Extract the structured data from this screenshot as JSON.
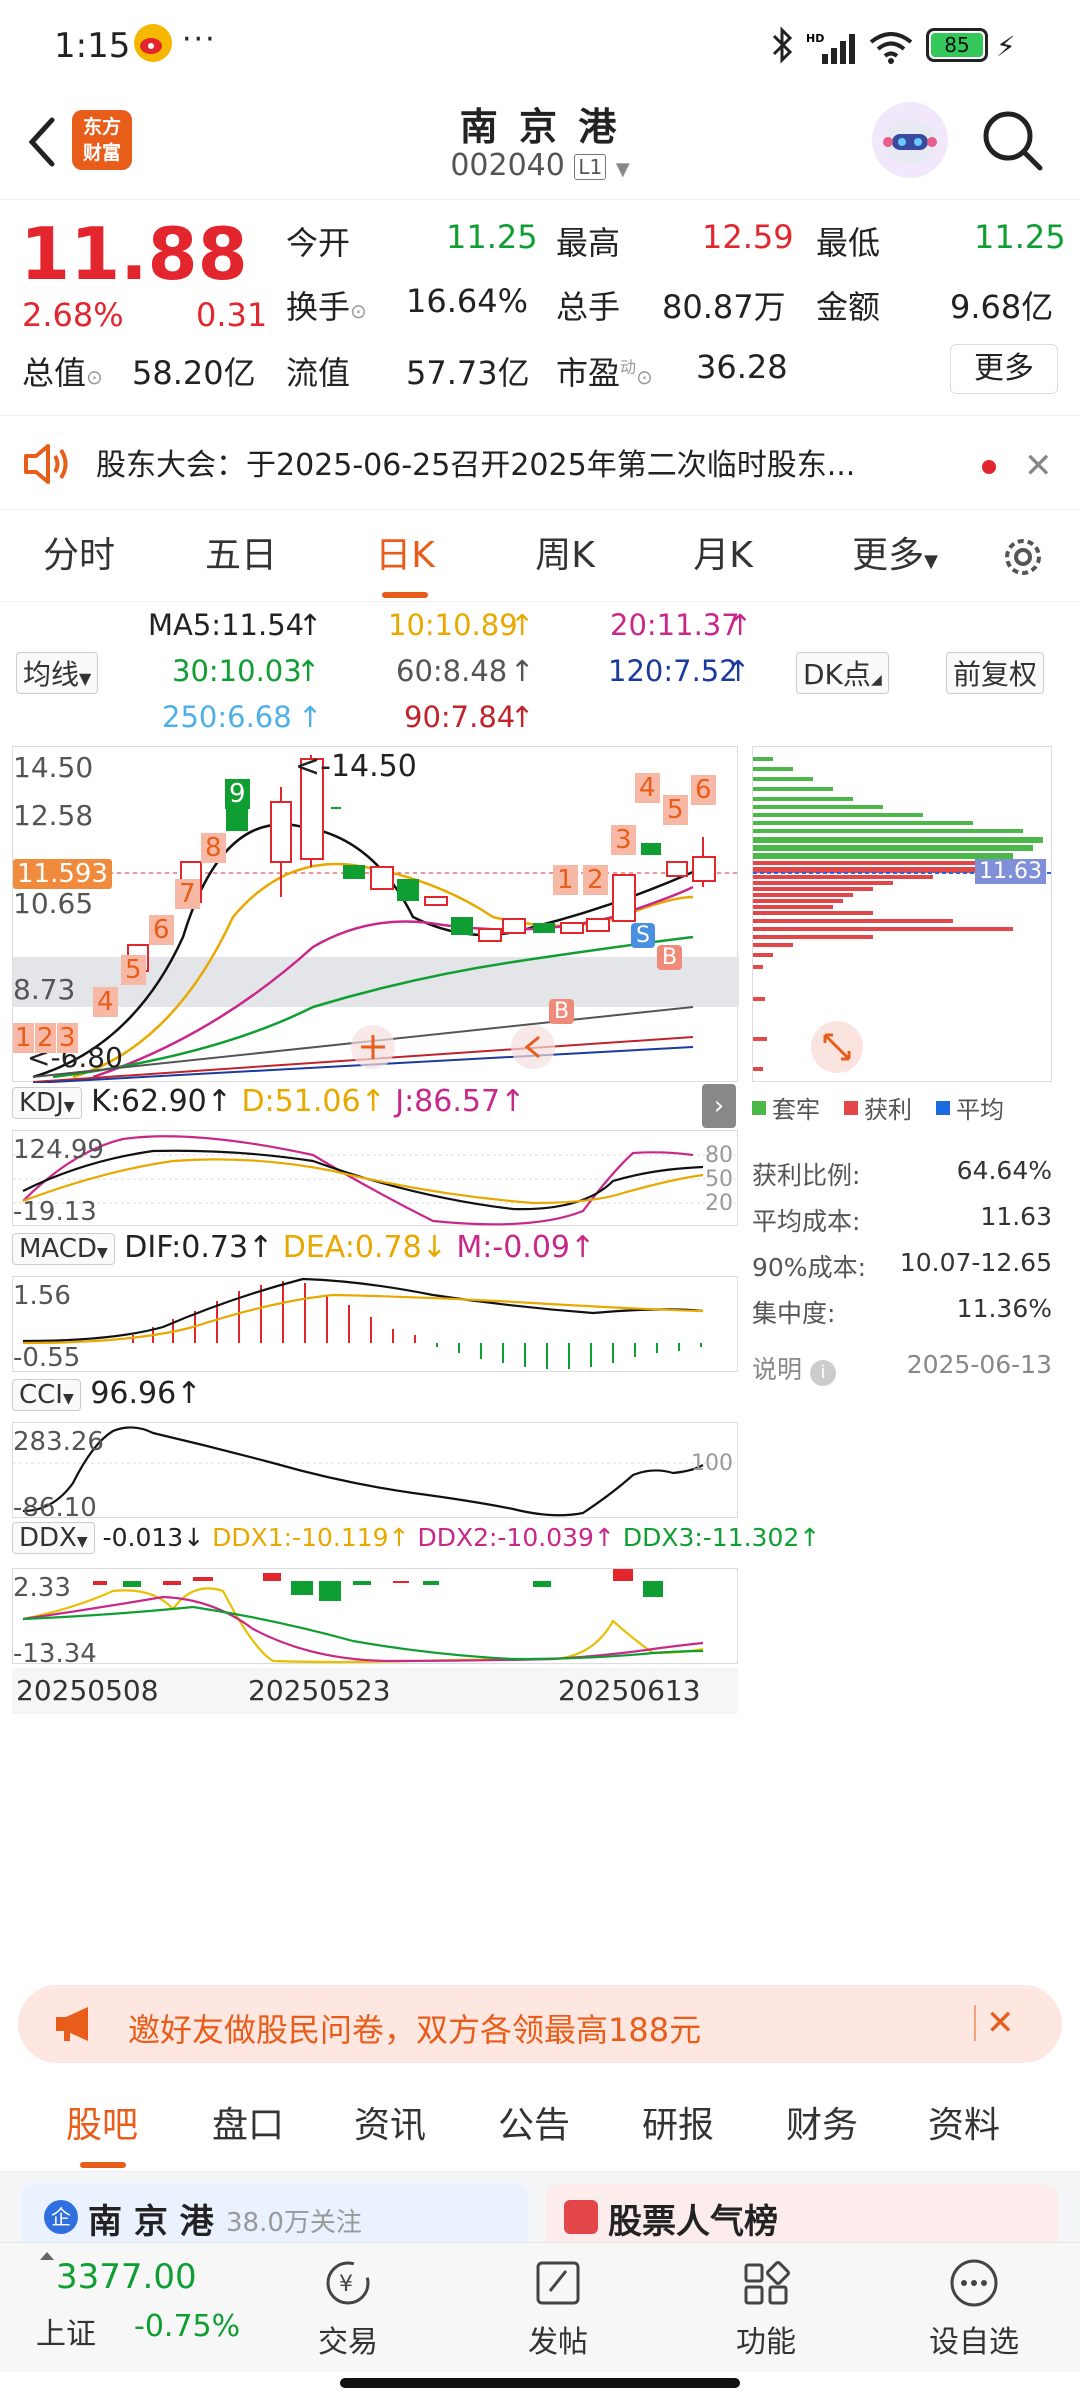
{
  "status_bar": {
    "time": "1:15",
    "dots": "···",
    "battery": "85"
  },
  "header": {
    "logo_line1": "东方",
    "logo_line2": "财富",
    "title": "南 京 港",
    "code": "002040",
    "level": "L1"
  },
  "quote": {
    "price": "11.88",
    "change_pct": "2.68%",
    "change": "0.31",
    "open_label": "今开",
    "open": "11.25",
    "high_label": "最高",
    "high": "12.59",
    "low_label": "最低",
    "low": "11.25",
    "turnover_label": "换手",
    "turnover": "16.64%",
    "vol_label": "总手",
    "vol": "80.87万",
    "amount_label": "金额",
    "amount": "9.68亿",
    "mcap_label": "总值",
    "mcap": "58.20亿",
    "float_label": "流值",
    "float": "57.73亿",
    "pe_label": "市盈",
    "pe_sup": "动",
    "pe": "36.28",
    "more": "更多"
  },
  "notice": {
    "text": "股东大会：于2025-06-25召开2025年第二次临时股东..."
  },
  "chart_tabs": [
    "分时",
    "五日",
    "日K",
    "周K",
    "月K",
    "更多"
  ],
  "ma": {
    "ma5": "MA5:11.54",
    "ma10": "10:10.89",
    "ma20": "20:11.37",
    "ma30": "30:10.03",
    "ma60": "60:8.48",
    "ma120": "120:7.52",
    "ma250": "250:6.68",
    "ma90": "90:7.84",
    "mode": "均线",
    "dk": "DK点",
    "adj": "前复权"
  },
  "kline": {
    "ticks": [
      "14.50",
      "12.58",
      "10.65",
      "8.73"
    ],
    "cur": "11.593",
    "hi_mark": "14.50",
    "lo_mark": "6.80",
    "seq": [
      "1",
      "2",
      "3",
      "4",
      "5",
      "6",
      "7",
      "8",
      "9",
      "1",
      "2",
      "3",
      "4",
      "5",
      "6"
    ],
    "signals": [
      "S",
      "B",
      "B"
    ]
  },
  "kdj": {
    "name": "KDJ",
    "k": "K:62.90",
    "d": "D:51.06",
    "j": "J:86.57",
    "top": "124.99",
    "bottom": "-19.13",
    "r80": "80",
    "r50": "50",
    "r20": "20"
  },
  "macd": {
    "name": "MACD",
    "dif": "DIF:0.73",
    "dea": "DEA:0.78",
    "m": "M:-0.09",
    "top": "1.56",
    "bottom": "-0.55"
  },
  "cci": {
    "name": "CCI",
    "v": "96.96",
    "top": "283.26",
    "bottom": "-86.10",
    "r100": "100"
  },
  "ddx": {
    "name": "DDX",
    "v": "-0.013",
    "d1": "DDX1:-10.119",
    "d2": "DDX2:-10.039",
    "d3": "DDX3:-11.302",
    "top": "2.33",
    "bottom": "-13.34"
  },
  "dates": [
    "20250508",
    "20250523",
    "20250613"
  ],
  "chips": {
    "price": "11.63",
    "legend_trap": "套牢",
    "legend_profit": "获利",
    "legend_avg": "平均",
    "stats": [
      {
        "k": "获利比例:",
        "v": "64.64%"
      },
      {
        "k": "平均成本:",
        "v": "11.63"
      },
      {
        "k": "90%成本:",
        "v": "10.07-12.65"
      },
      {
        "k": "集中度:",
        "v": "11.36%"
      }
    ],
    "note": "说明",
    "date": "2025-06-13"
  },
  "promo": {
    "text": "邀好友做股民问卷，双方各领最高188元"
  },
  "bottom_tabs": [
    "股吧",
    "盘口",
    "资讯",
    "公告",
    "研报",
    "财务",
    "资料"
  ],
  "cards": {
    "left_title": "南 京 港",
    "left_sub": "38.0万关注",
    "right_title": "股票人气榜"
  },
  "footer": {
    "index_value": "3377.00",
    "index_name": "上证",
    "index_change": "-0.75%",
    "trade": "交易",
    "post": "发帖",
    "func": "功能",
    "watch": "设自选"
  },
  "colors": {
    "accent": "#e85d1a",
    "up": "#e3262e",
    "down": "#0e9e32"
  }
}
